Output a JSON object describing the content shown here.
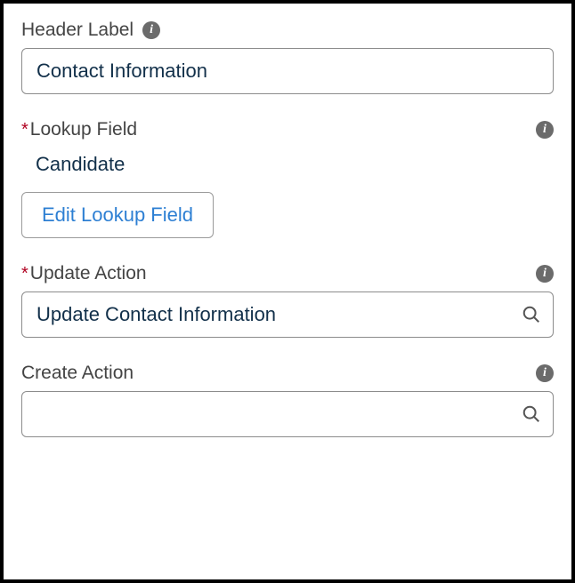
{
  "headerLabel": {
    "label": "Header Label",
    "value": "Contact Information"
  },
  "lookupField": {
    "label": "Lookup Field",
    "required": true,
    "value": "Candidate",
    "editButton": "Edit Lookup Field"
  },
  "updateAction": {
    "label": "Update Action",
    "required": true,
    "value": "Update Contact Information"
  },
  "createAction": {
    "label": "Create Action",
    "value": ""
  }
}
